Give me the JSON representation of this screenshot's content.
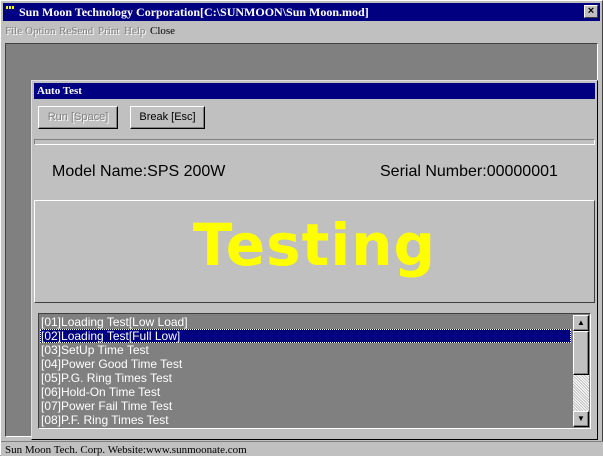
{
  "window": {
    "title": "Sun Moon Technology Corporation[C:\\SUNMOON\\Sun Moon.mod]",
    "close_glyph": "×"
  },
  "menu": [
    {
      "label": "File",
      "enabled": false
    },
    {
      "label": "Option",
      "enabled": false
    },
    {
      "label": "ReSend",
      "enabled": false
    },
    {
      "label": "Print",
      "enabled": false
    },
    {
      "label": "Help",
      "enabled": false
    },
    {
      "label": "Close",
      "enabled": true
    }
  ],
  "auto_test": {
    "title": "Auto Test",
    "run_button": "Run [Space]",
    "break_button": "Break [Esc]",
    "model_name": "Model Name:SPS 200W",
    "serial_number": "Serial Number:00000001",
    "status": "Testing",
    "status_color": "#ffff00",
    "tests": [
      "[01]Loading Test[Low Load]",
      "[02]Loading Test[Full Low]",
      "[03]SetUp Time Test",
      "[04]Power Good Time Test",
      "[05]P.G. Ring Times Test",
      "[06]Hold-On Time Test",
      "[07]Power Fail Time Test",
      "[08]P.F. Ring Times Test"
    ],
    "selected_test_index": 1
  },
  "statusbar": {
    "text": "Sun Moon Tech. Corp.  Website:www.sunmoonate.com"
  },
  "colors": {
    "titlebar": "#000080",
    "face": "#c0c0c0",
    "workspace": "#808080"
  }
}
